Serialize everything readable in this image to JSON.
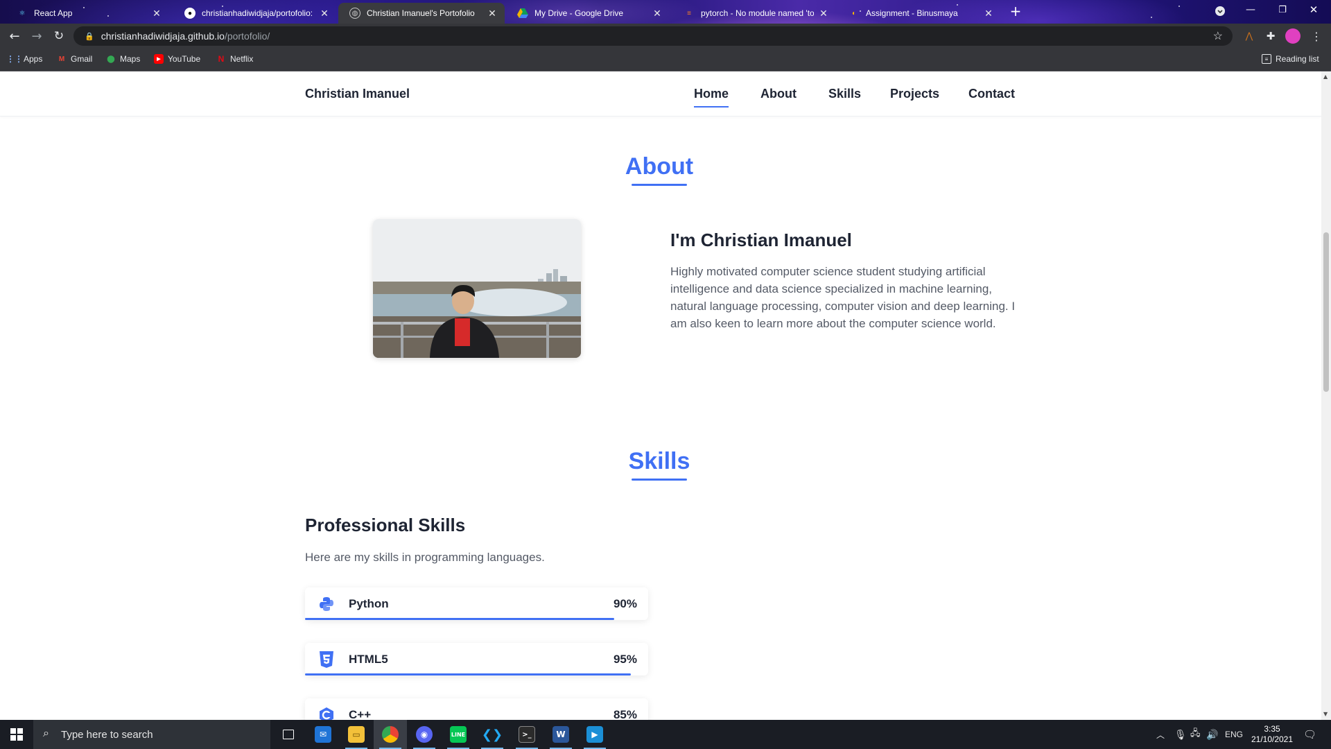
{
  "browser": {
    "tabs": [
      {
        "title": "React App"
      },
      {
        "title": "christianhadiwidjaja/portofolio: n"
      },
      {
        "title": "Christian Imanuel's Portofolio"
      },
      {
        "title": "My Drive - Google Drive"
      },
      {
        "title": "pytorch - No module named 'tor"
      },
      {
        "title": "Assignment - Binusmaya"
      }
    ],
    "url_host": "christianhadiwidjaja.github.io",
    "url_path": "/portofolio/",
    "bookmarks": [
      "Apps",
      "Gmail",
      "Maps",
      "YouTube",
      "Netflix"
    ],
    "reading_list": "Reading list"
  },
  "site": {
    "brand": "Christian Imanuel",
    "nav": [
      "Home",
      "About",
      "Skills",
      "Projects",
      "Contact"
    ],
    "active_nav": "Home"
  },
  "about": {
    "section_title": "About",
    "heading": "I'm Christian Imanuel",
    "text": "Highly motivated computer science student studying artificial intelligence and data science specialized in machine learning, natural language processing, computer vision and deep learning. I am also keen to learn more about the computer science world."
  },
  "skills": {
    "section_title": "Skills",
    "heading": "Professional Skills",
    "description": "Here are my skills in programming languages.",
    "items": [
      {
        "name": "Python",
        "percent": "90%",
        "level": 0.9,
        "icon": "python-icon"
      },
      {
        "name": "HTML5",
        "percent": "95%",
        "level": 0.95,
        "icon": "html5-icon"
      },
      {
        "name": "C++",
        "percent": "85%",
        "level": 0.85,
        "icon": "cplusplus-icon"
      }
    ]
  },
  "taskbar": {
    "search_placeholder": "Type here to search",
    "language": "ENG",
    "time": "3:35",
    "date": "21/10/2021"
  },
  "colors": {
    "accent": "#4070f4",
    "text_dark": "#1e2433",
    "text_body": "#545a66"
  }
}
